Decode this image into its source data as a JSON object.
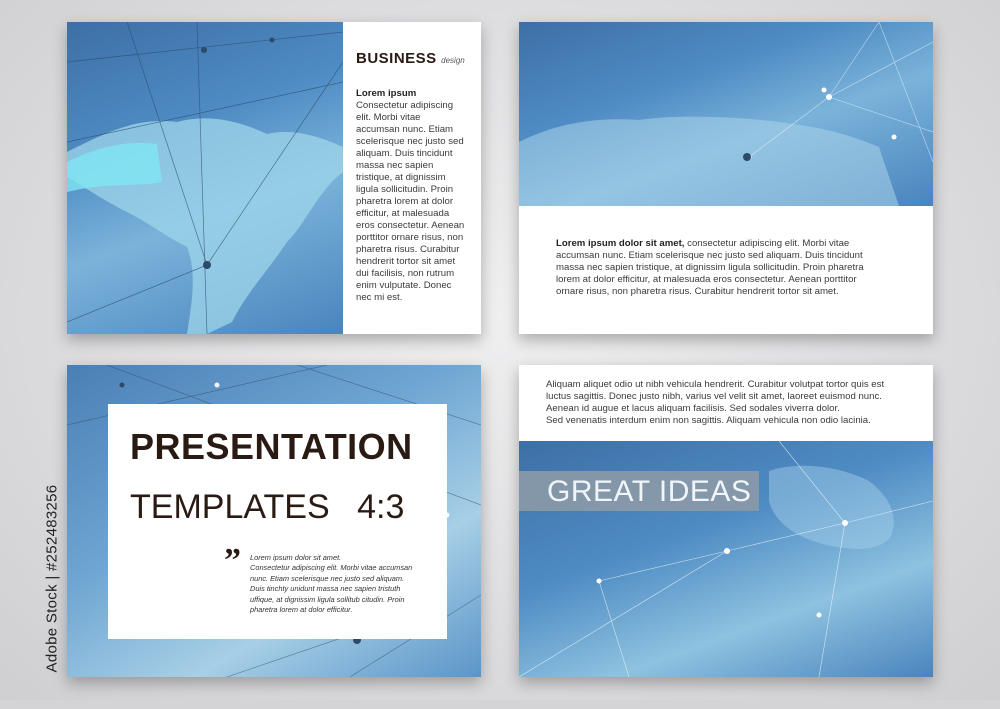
{
  "slide1": {
    "brand_bold": "BUSINESS",
    "brand_light": "design",
    "heading": "Lorem ipsum",
    "lines": [
      "Consectetur adipiscing",
      "elit. Morbi vitae",
      "accumsan nunc. Etiam",
      "scelerisque nec justo sed",
      "aliquam. Duis tincidunt",
      "massa nec sapien",
      "tristique, at dignissim",
      "ligula sollicitudin. Proin",
      "pharetra lorem at dolor",
      "efficitur, at malesuada",
      "eros consectetur. Aenean",
      "porttitor ornare risus, non",
      "pharetra risus. Curabitur",
      "hendrerit tortor sit amet",
      "dui facilisis, non rutrum",
      "enim vulputate. Donec",
      "nec mi est."
    ]
  },
  "slide2": {
    "lead": "Lorem ipsum dolor sit amet,",
    "line1_rest": " consectetur adipiscing elit. Morbi vitae",
    "lines": [
      "accumsan nunc. Etiam scelerisque nec justo sed aliquam. Duis tincidunt",
      "massa nec sapien tristique, at dignissim ligula sollicitudin. Proin pharetra",
      "lorem at dolor efficitur, at malesuada eros consectetur. Aenean porttitor",
      "ornare risus, non pharetra risus. Curabitur hendrerit tortor sit amet."
    ]
  },
  "slide3": {
    "title": "PRESENTATION",
    "subtitle_word": "TEMPLATES",
    "ratio": "4:3",
    "quote_mark": "”",
    "quote_lines": [
      "Lorem ipsum dolor sit amet.",
      "Consectetur adipiscing elit. Morbi vitae accumsan",
      "nunc. Etiam scelerisque nec justo sed aliquam.",
      "Duis tinchty unidunt massa nec sapien tristuth",
      "uffique, at dignissim ligula sollitub citudin. Proin",
      "pharetra lorem at dolor efficitur."
    ]
  },
  "slide4": {
    "lines": [
      "Aliquam aliquet odio ut nibh vehicula hendrerit. Curabitur volutpat tortor quis est",
      "luctus sagittis. Donec justo nibh, varius vel velit sit amet, laoreet euismod nunc.",
      "Aenean id augue et lacus aliquam facilisis. Sed sodales viverra dolor.",
      "Sed venenatis interdum enim non sagittis. Aliquam vehicula non odio lacinia."
    ],
    "banner": "GREAT IDEAS"
  },
  "watermark": {
    "side_text": "Adobe Stock | #252483256"
  },
  "colors": {
    "accent_blue": "#4a84bd",
    "dark_text": "#2a1a14",
    "banner_bg": "#8a9aa8"
  }
}
